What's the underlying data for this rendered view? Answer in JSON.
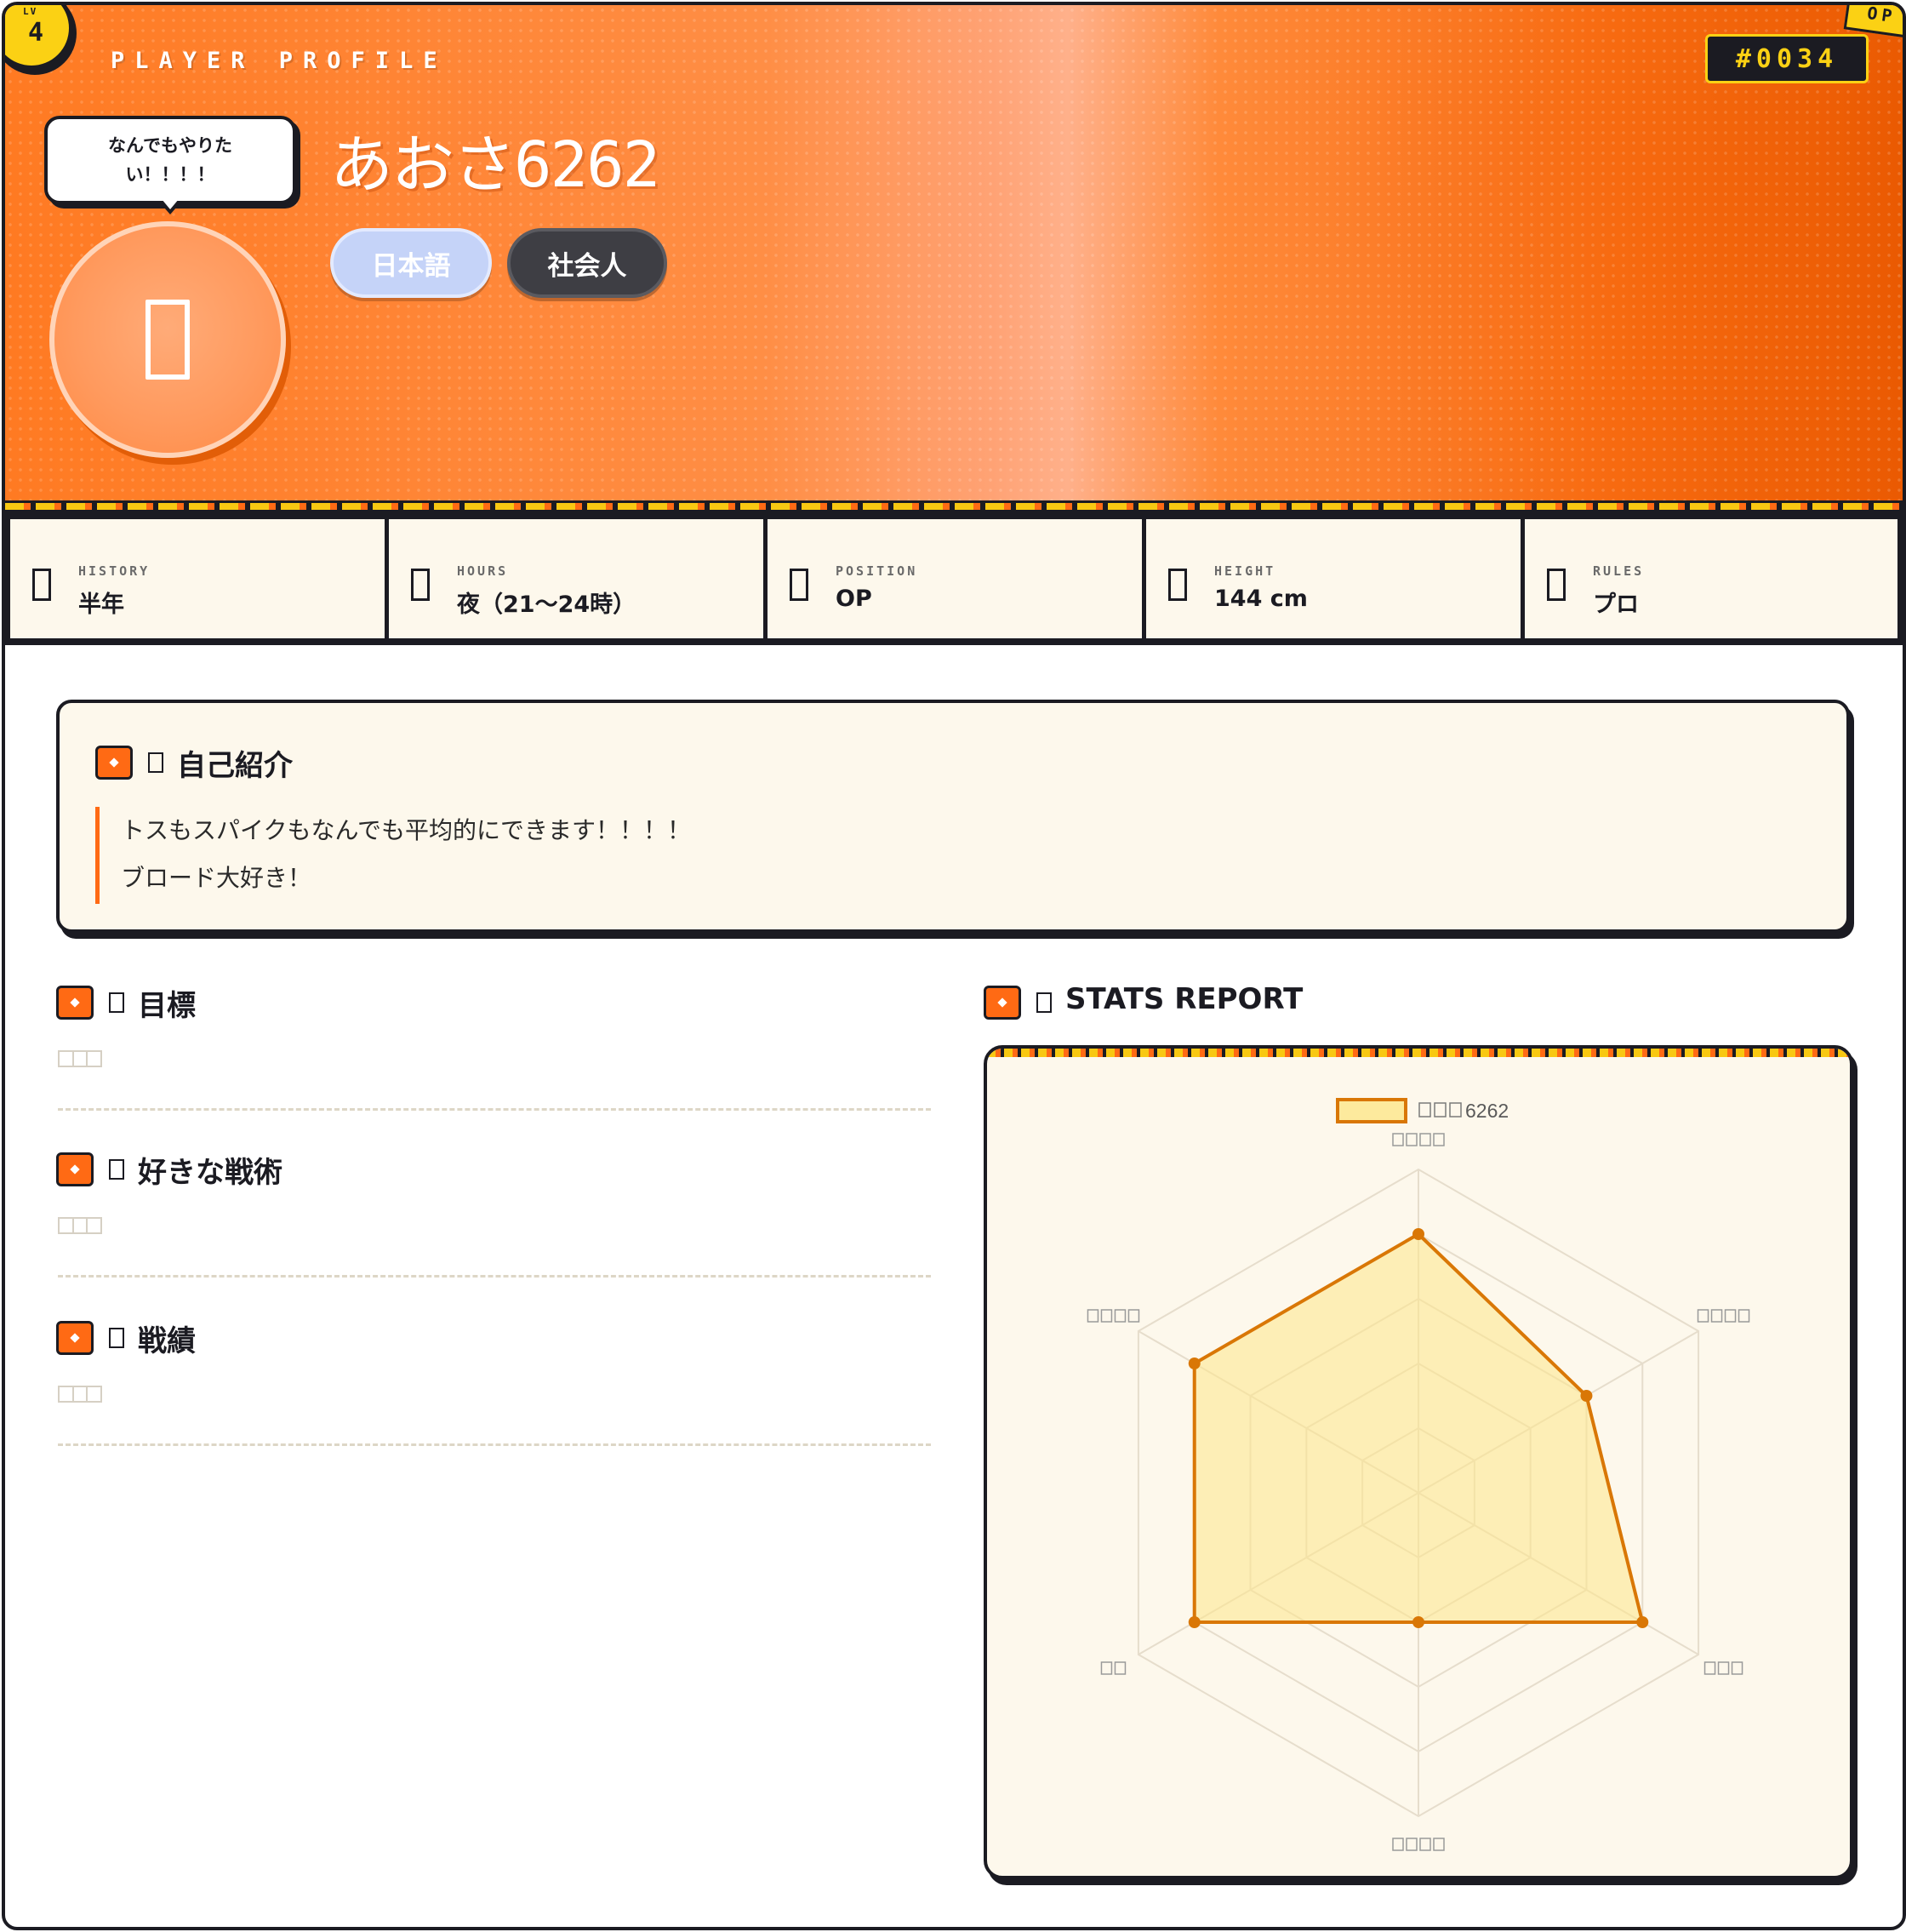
{
  "hero": {
    "level_label": "LV",
    "level": "4",
    "section_label": "PLAYER PROFILE",
    "player_id": "#0034",
    "corner_tag": "OP",
    "speech": "なんでもやりたい！！！！",
    "name": "あおさ6262",
    "tags": [
      "日本語",
      "社会人"
    ],
    "avatar_icon": "user-icon"
  },
  "stats": [
    {
      "key": "HISTORY",
      "value": "半年",
      "icon": "calendar-icon"
    },
    {
      "key": "HOURS",
      "value": "夜（21〜24時）",
      "icon": "clock-icon"
    },
    {
      "key": "POSITION",
      "value": "OP",
      "icon": "volleyball-icon"
    },
    {
      "key": "HEIGHT",
      "value": "144 cm",
      "icon": "ruler-icon"
    },
    {
      "key": "RULES",
      "value": "プロ",
      "icon": "trophy-icon"
    }
  ],
  "intro": {
    "title": "自己紹介",
    "lines": [
      "トスもスパイクもなんでも平均的にできます！！！！",
      "ブロード大好き！"
    ]
  },
  "sections": [
    {
      "title": "目標",
      "icon": "target-icon"
    },
    {
      "title": "好きな戦術",
      "icon": "tactics-icon"
    },
    {
      "title": "戦績",
      "icon": "medal-icon"
    }
  ],
  "stats_report": {
    "title": "STATS REPORT"
  },
  "colors": {
    "accent": "#ff6a14",
    "dark": "#1b1b22",
    "yellow": "#fbd114",
    "radar_line": "#d97706",
    "radar_fill": "#fde68a"
  },
  "chart_data": {
    "type": "radar",
    "legend_suffix": "6262",
    "legend_position": "top",
    "axis_count": 6,
    "range": [
      0,
      5
    ],
    "series": [
      {
        "values": [
          4,
          3,
          4,
          2,
          4,
          4
        ]
      }
    ]
  }
}
